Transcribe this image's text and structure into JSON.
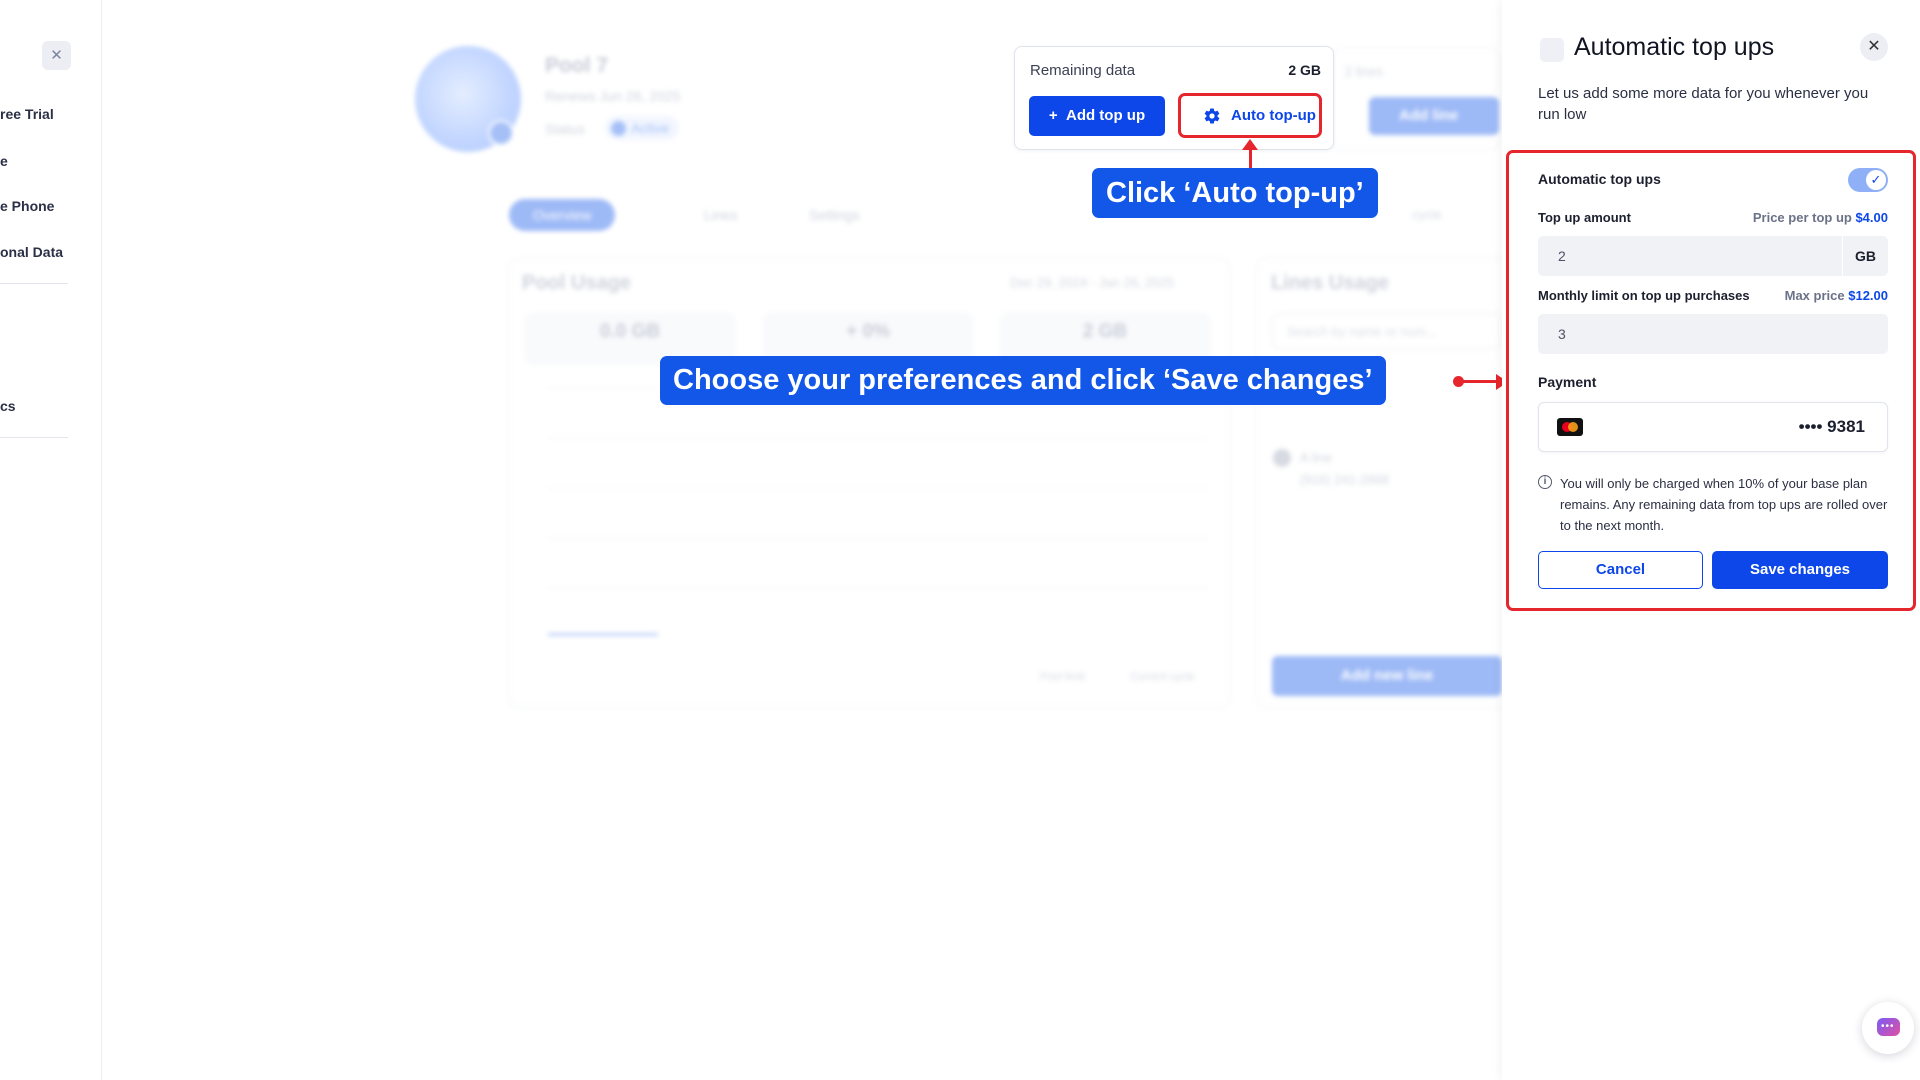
{
  "sidebar": {
    "items": [
      {
        "label": "ree Trial"
      },
      {
        "label": "e"
      },
      {
        "label": "e Phone"
      },
      {
        "label": "onal Data"
      },
      {
        "label": "cs"
      }
    ]
  },
  "background": {
    "pool_name": "Pool 7",
    "renews": "Renews Jun 26, 2025",
    "status_label": "Status",
    "status_value": "Active",
    "tabs": [
      "Overview",
      "Lines",
      "Settings"
    ],
    "pool_usage_title": "Pool Usage",
    "date_range": "Dec 29, 2024 - Jan 26, 2025",
    "stats": [
      "0.0 GB",
      "+ 0%",
      "2 GB"
    ],
    "lines_usage_title": "Lines Usage",
    "search_placeholder": "Search by name or num...",
    "line_name": "A line",
    "line_number": "(916) 241-2868",
    "add_new_line": "Add new line",
    "lines_count": "2 lines",
    "add_line": "Add line",
    "cycle": "cycle",
    "legend": [
      "Pool limit",
      "Current cycle"
    ]
  },
  "remaining": {
    "label": "Remaining data",
    "value": "2 GB",
    "add_top_up": "Add top up",
    "auto_top_up": "Auto top-up"
  },
  "annotations": {
    "click_auto": "Click ‘Auto top-up’",
    "choose_prefs": "Choose your preferences and click ‘Save changes’"
  },
  "panel": {
    "title": "Automatic top ups",
    "subtitle": "Let us add some more data for you whenever you run low",
    "toggle_label": "Automatic top ups",
    "toggle_on": true,
    "top_up_amount_label": "Top up amount",
    "price_per_label": "Price per top up",
    "price_per_value": "$4.00",
    "top_up_amount_value": "2",
    "top_up_unit": "GB",
    "monthly_limit_label": "Monthly limit on top up purchases",
    "max_price_label": "Max price",
    "max_price_value": "$12.00",
    "monthly_limit_value": "3",
    "payment_label": "Payment",
    "card_number": "•••• 9381",
    "note": "You will only be charged when 10% of your base plan remains. Any remaining data from top ups are rolled over to the next month.",
    "cancel": "Cancel",
    "save": "Save changes"
  },
  "colors": {
    "primary": "#0d47e9",
    "annotation_red": "#e5262c",
    "callout_blue": "#1257e8"
  }
}
